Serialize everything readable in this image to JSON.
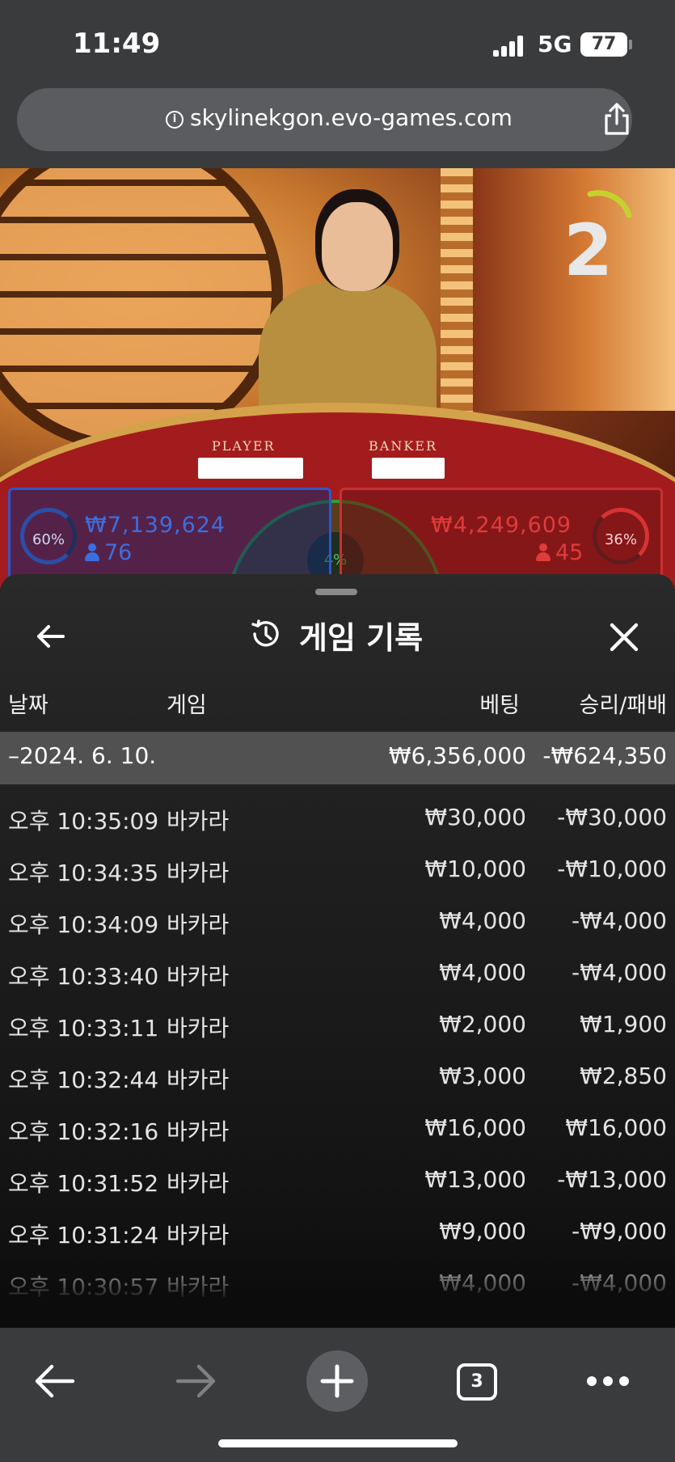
{
  "status_bar": {
    "time": "11:49",
    "network": "5G",
    "battery": "77"
  },
  "browser": {
    "url": "skylinekgon.evo-games.com"
  },
  "game_view": {
    "countdown": "2",
    "table_labels": {
      "player": "PLAYER",
      "banker": "BANKER"
    },
    "player": {
      "percent": "60%",
      "amount": "₩7,139,624",
      "count": "76",
      "color": "#3b6fe0"
    },
    "banker": {
      "percent": "36%",
      "amount": "₩4,249,609",
      "count": "45",
      "color": "#e03b3b"
    },
    "tie": {
      "percent": "4%",
      "color": "#55c855"
    }
  },
  "history": {
    "title": "게임 기록",
    "columns": {
      "date": "날짜",
      "game": "게임",
      "bet": "베팅",
      "result": "승리/패배"
    },
    "day": {
      "date": "–2024. 6. 10.",
      "bet": "₩6,356,000",
      "result": "-₩624,350"
    },
    "rows": [
      {
        "time": "오후 10:35:09",
        "game": "바카라",
        "bet": "₩30,000",
        "result": "-₩30,000"
      },
      {
        "time": "오후 10:34:35",
        "game": "바카라",
        "bet": "₩10,000",
        "result": "-₩10,000"
      },
      {
        "time": "오후 10:34:09",
        "game": "바카라",
        "bet": "₩4,000",
        "result": "-₩4,000"
      },
      {
        "time": "오후 10:33:40",
        "game": "바카라",
        "bet": "₩4,000",
        "result": "-₩4,000"
      },
      {
        "time": "오후 10:33:11",
        "game": "바카라",
        "bet": "₩2,000",
        "result": "₩1,900"
      },
      {
        "time": "오후 10:32:44",
        "game": "바카라",
        "bet": "₩3,000",
        "result": "₩2,850"
      },
      {
        "time": "오후 10:32:16",
        "game": "바카라",
        "bet": "₩16,000",
        "result": "₩16,000"
      },
      {
        "time": "오후 10:31:52",
        "game": "바카라",
        "bet": "₩13,000",
        "result": "-₩13,000"
      },
      {
        "time": "오후 10:31:24",
        "game": "바카라",
        "bet": "₩9,000",
        "result": "-₩9,000"
      },
      {
        "time": "오후 10:30:57",
        "game": "바카라",
        "bet": "₩4,000",
        "result": "-₩4,000"
      }
    ]
  },
  "toolbar": {
    "tab_count": "3"
  }
}
